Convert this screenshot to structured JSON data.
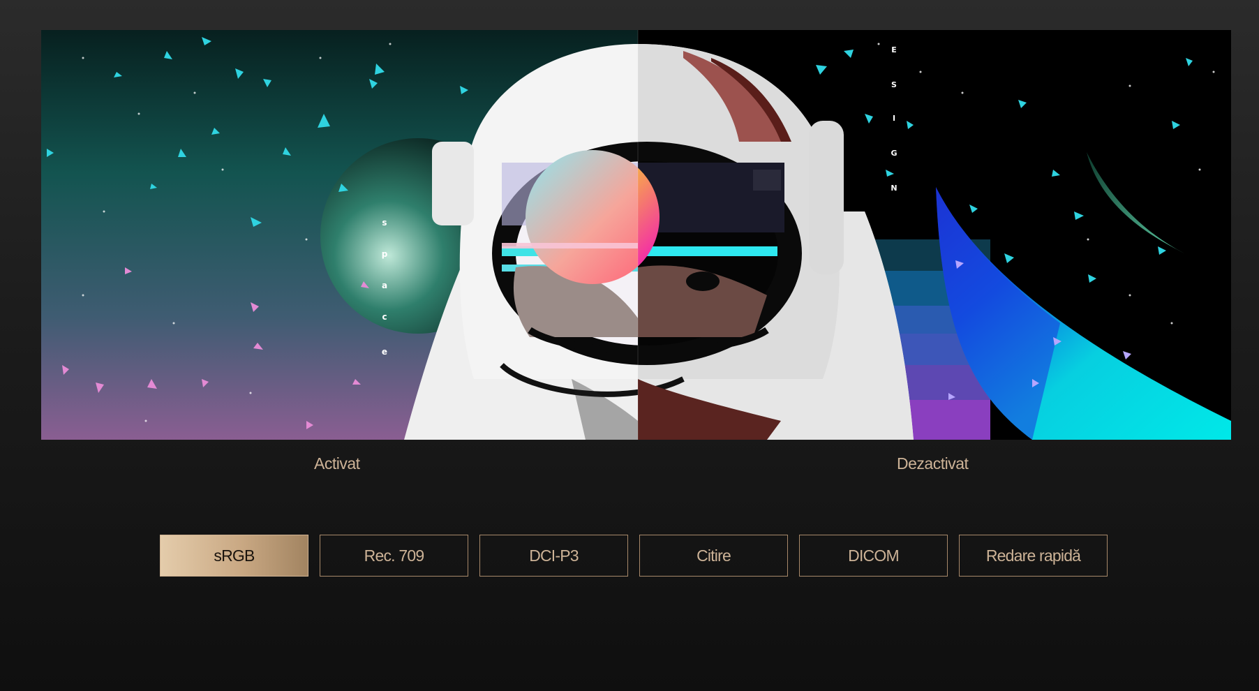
{
  "comparison": {
    "left_label": "Activat",
    "right_label": "Dezactivat",
    "artwork_text_left": [
      "s",
      "p",
      "a",
      "c",
      "e"
    ],
    "artwork_text_right": [
      "E",
      "S",
      "I",
      "G",
      "N"
    ]
  },
  "modes": {
    "selected": "sRGB",
    "items": [
      {
        "label": "sRGB"
      },
      {
        "label": "Rec. 709"
      },
      {
        "label": "DCI-P3"
      },
      {
        "label": "Citire"
      },
      {
        "label": "DICOM"
      },
      {
        "label": "Redare rapidă"
      }
    ]
  },
  "colors": {
    "accent": "#cdb397",
    "active_button_start": "#e4ccab",
    "active_button_end": "#a28461",
    "background": "#1c1c1c"
  }
}
